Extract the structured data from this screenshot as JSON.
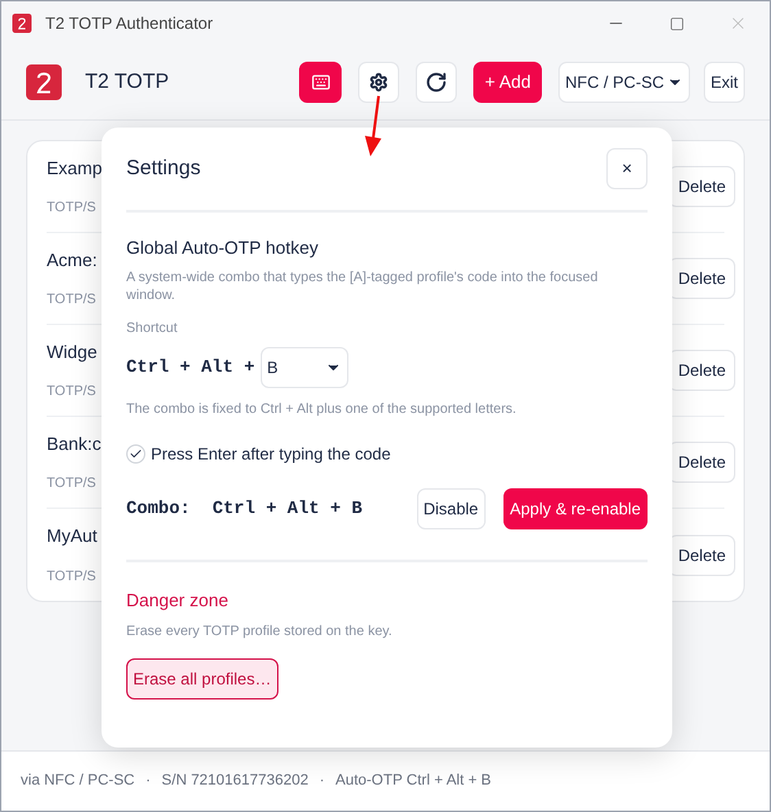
{
  "window": {
    "title": "T2 TOTP Authenticator"
  },
  "header": {
    "app_name": "T2 TOTP",
    "tools": [
      {
        "kind": "keyboard",
        "selected": true
      },
      {
        "kind": "settings",
        "selected": false
      },
      {
        "kind": "refresh",
        "selected": false
      },
      {
        "kind": "add",
        "label": "+ Add"
      }
    ],
    "transport": "NFC / PC-SC",
    "exit": "Exit"
  },
  "profiles": [
    {
      "name": "Examp",
      "type": "TOTP/S",
      "action": "Delete"
    },
    {
      "name": "Acme:",
      "type": "TOTP/S",
      "action": "Delete"
    },
    {
      "name": "Widge",
      "type": "TOTP/S",
      "action": "Delete"
    },
    {
      "name": "Bank:c",
      "type": "TOTP/S",
      "action": "Delete"
    },
    {
      "name": "MyAut",
      "type": "TOTP/S",
      "action": "Delete"
    }
  ],
  "settings": {
    "title": "Settings",
    "close": "×",
    "hotkey": {
      "heading": "Global Auto-OTP hotkey",
      "description": "A system-wide combo that types the [A]-tagged profile's code into the focused window.",
      "shortcut_label": "Shortcut",
      "prefix": "Ctrl + Alt +",
      "key": "B",
      "note": "The combo is fixed to Ctrl + Alt plus one of the supported letters.",
      "press_enter": {
        "label": "Press Enter after typing the code",
        "checked": true
      },
      "combo_label": "Combo:",
      "combo": "Ctrl + Alt + B",
      "disable": "Disable",
      "apply": "Apply & re-enable"
    },
    "danger": {
      "heading": "Danger zone",
      "description": "Erase every TOTP profile stored on the key.",
      "button": "Erase all profiles…"
    }
  },
  "status_bar": {
    "separator": "·",
    "items": [
      "via NFC / PC-SC",
      "S/N 72101617736202",
      "Auto-OTP Ctrl + Alt + B"
    ]
  }
}
